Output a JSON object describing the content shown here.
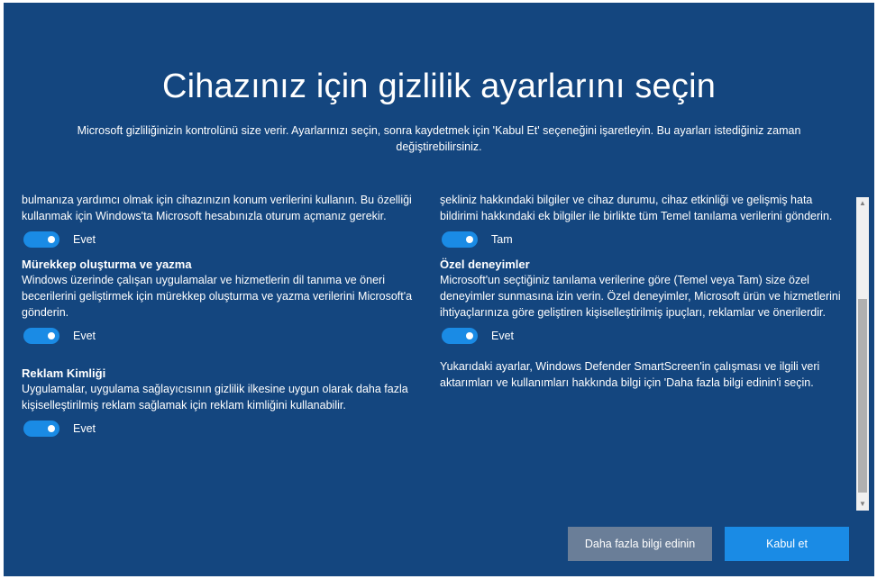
{
  "header": {
    "title": "Cihazınız için gizlilik ayarlarını seçin",
    "subtitle": "Microsoft gizliliğinizin kontrolünü size verir. Ayarlarınızı seçin, sonra kaydetmek için 'Kabul Et' seçeneğini işaretleyin. Bu ayarları istediğiniz zaman değiştirebilirsiniz."
  },
  "left_column": {
    "location": {
      "desc": "bulmanıza yardımcı olmak için cihazınızın konum verilerini kullanın. Bu özelliği kullanmak için Windows'ta Microsoft hesabınızla oturum açmanız gerekir.",
      "toggle_state": "on",
      "toggle_label": "Evet"
    },
    "inking": {
      "title": "Mürekkep oluşturma ve yazma",
      "desc": "Windows üzerinde çalışan uygulamalar ve hizmetlerin dil tanıma ve öneri becerilerini geliştirmek için mürekkep oluşturma ve yazma verilerini Microsoft'a gönderin.",
      "toggle_state": "on",
      "toggle_label": "Evet"
    },
    "ad_id": {
      "title": "Reklam Kimliği",
      "desc": "Uygulamalar, uygulama sağlayıcısının gizlilik ilkesine uygun olarak daha fazla kişiselleştirilmiş reklam sağlamak için reklam kimliğini kullanabilir.",
      "toggle_state": "on",
      "toggle_label": "Evet"
    }
  },
  "right_column": {
    "diagnostics": {
      "desc": "şekliniz hakkındaki bilgiler ve cihaz durumu, cihaz etkinliği ve gelişmiş hata bildirimi hakkındaki ek bilgiler ile birlikte tüm Temel tanılama verilerini gönderin.",
      "toggle_state": "on",
      "toggle_label": "Tam"
    },
    "tailored": {
      "title": "Özel deneyimler",
      "desc": "Microsoft'un seçtiğiniz tanılama verilerine göre (Temel veya Tam) size özel deneyimler sunmasına izin verin. Özel deneyimler, Microsoft ürün ve hizmetlerini ihtiyaçlarınıza göre geliştiren kişiselleştirilmiş ipuçları, reklamlar ve önerilerdir.",
      "toggle_state": "on",
      "toggle_label": "Evet"
    },
    "footer_note": "Yukarıdaki ayarlar, Windows Defender SmartScreen'in çalışması ve ilgili veri aktarımları ve kullanımları hakkında bilgi için 'Daha fazla bilgi edinin'i seçin."
  },
  "scrollbar": {
    "up_icon": "chevron-up-icon",
    "down_icon": "chevron-down-icon"
  },
  "buttons": {
    "learn_more": "Daha fazla bilgi edinin",
    "accept": "Kabul et"
  },
  "colors": {
    "background": "#14467f",
    "accent": "#1a8be5",
    "secondary_button": "#6a7e98",
    "text": "#ffffff"
  }
}
